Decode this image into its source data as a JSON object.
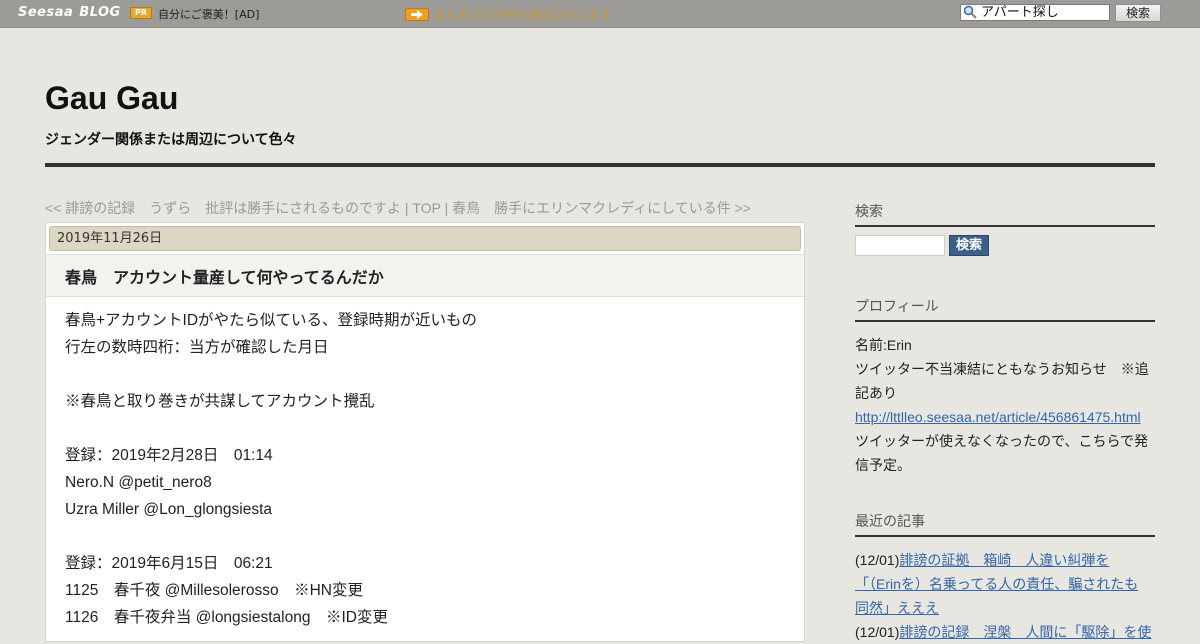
{
  "topbar": {
    "logo_seesaa": "Seesaa",
    "logo_blog": "BLOG",
    "pr_badge": "PR",
    "pr_text": "自分にご褒美！[AD]",
    "notice": "まとめブログ続々追加されてます",
    "search_value": "アパート探し",
    "search_button": "検索"
  },
  "header": {
    "title": "Gau Gau",
    "description": "ジェンダー関係または周辺について色々"
  },
  "nav": {
    "prev": "<< 誹謗の記録　うずら　批評は勝手にされるものですよ",
    "sep1": " | ",
    "top": "TOP",
    "sep2": " | ",
    "next": "春鳥　勝手にエリンマクレディにしている件 >>"
  },
  "article": {
    "date": "2019年11月26日",
    "title": "春鳥　アカウント量産して何やってるんだか",
    "body": [
      "春鳥+アカウントIDがやたら似ている、登録時期が近いもの",
      "行左の数時四桁：当方が確認した月日",
      "",
      "※春鳥と取り巻きが共謀してアカウント攪乱",
      "",
      "登録：2019年2月28日　01:14",
      "Nero.N @petit_nero8",
      "Uzra Miller @Lon_glongsiesta",
      "",
      "登録：2019年6月15日　06:21",
      "1125　春千夜 @Millesolerosso　※HN変更",
      "1126　春千夜弁当 @longsiestalong　※ID変更"
    ]
  },
  "sidebar": {
    "search_heading": "検索",
    "search_button": "検索",
    "profile_heading": "プロフィール",
    "profile_name": "名前:Erin",
    "profile_line1": "ツイッター不当凍結にともなうお知らせ　※追",
    "profile_line2": "記あり",
    "profile_link": "http://lttlleo.seesaa.net/article/456861475.html",
    "profile_line3": "ツイッターが使えなくなったので、こちらで発",
    "profile_line4": "信予定。",
    "recent_heading": "最近の記事",
    "recent": [
      {
        "date": "(12/01)",
        "line1": "誹謗の証拠　箱崎　人違い糾弾を",
        "line2": "「（Erinを）名乗ってる人の責任、騙されたも",
        "line3": "同然」えええ"
      },
      {
        "date": "(12/01)",
        "line1": "誹謗の記録　涅槃　人間に「駆除」を使"
      }
    ]
  },
  "colors": {
    "topbar": "#9c9b98",
    "background": "#e8e6e1",
    "link": "#3366a8",
    "search_button": "#3d5f8a",
    "date_bar": "#dcd6c2"
  }
}
